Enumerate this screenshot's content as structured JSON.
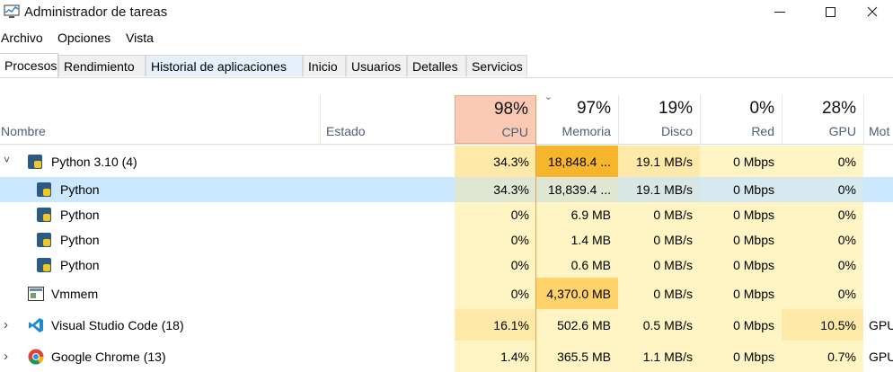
{
  "window": {
    "title": "Administrador de tareas",
    "controls": {
      "minimize": "—",
      "maximize": "☐",
      "close": "✕"
    }
  },
  "menu": [
    "Archivo",
    "Opciones",
    "Vista"
  ],
  "tabs": [
    {
      "label": "Procesos",
      "active": true
    },
    {
      "label": "Rendimiento"
    },
    {
      "label": "Historial de aplicaciones",
      "highlight": true
    },
    {
      "label": "Inicio"
    },
    {
      "label": "Usuarios"
    },
    {
      "label": "Detalles"
    },
    {
      "label": "Servicios"
    }
  ],
  "columns": {
    "name": "Nombre",
    "status": "Estado",
    "cpu": {
      "pct": "98%",
      "label": "CPU"
    },
    "memory": {
      "pct": "97%",
      "label": "Memoria",
      "sort_indicator": "ˇ"
    },
    "disk": {
      "pct": "19%",
      "label": "Disco"
    },
    "network": {
      "pct": "0%",
      "label": "Red"
    },
    "gpu": {
      "pct": "28%",
      "label": "GPU"
    },
    "gpu_engine": {
      "label": "Mot"
    }
  },
  "rows": [
    {
      "name": "Python 3.10 (4)",
      "expand": "˅",
      "cpu": "34.3%",
      "mem": "18,848.4 ...",
      "disk": "19.1 MB/s",
      "net": "0 Mbps",
      "gpu": "0%",
      "engine": ""
    },
    {
      "name": "Python",
      "cpu": "34.3%",
      "mem": "18,839.4 ...",
      "disk": "19.1 MB/s",
      "net": "0 Mbps",
      "gpu": "0%",
      "engine": ""
    },
    {
      "name": "Python",
      "cpu": "0%",
      "mem": "6.9 MB",
      "disk": "0 MB/s",
      "net": "0 Mbps",
      "gpu": "0%",
      "engine": ""
    },
    {
      "name": "Python",
      "cpu": "0%",
      "mem": "1.4 MB",
      "disk": "0 MB/s",
      "net": "0 Mbps",
      "gpu": "0%",
      "engine": ""
    },
    {
      "name": "Python",
      "cpu": "0%",
      "mem": "0.6 MB",
      "disk": "0 MB/s",
      "net": "0 Mbps",
      "gpu": "0%",
      "engine": ""
    },
    {
      "name": "Vmmem",
      "cpu": "0%",
      "mem": "4,370.0 MB",
      "disk": "0 MB/s",
      "net": "0 Mbps",
      "gpu": "0%",
      "engine": ""
    },
    {
      "name": "Visual Studio Code (18)",
      "expand": "›",
      "cpu": "16.1%",
      "mem": "502.6 MB",
      "disk": "0.5 MB/s",
      "net": "0 Mbps",
      "gpu": "10.5%",
      "engine": "GPU"
    },
    {
      "name": "Google Chrome (13)",
      "expand": "›",
      "cpu": "1.4%",
      "mem": "365.5 MB",
      "disk": "1.1 MB/s",
      "net": "0 Mbps",
      "gpu": "0.7%",
      "engine": "GPU"
    }
  ],
  "colors": {
    "heat_light": "#fff4c4",
    "heat_mid": "#ffe9a8",
    "heat_strong": "#ffd26a",
    "heat_max": "#f7b52c",
    "cpu_header": "#f9c9b3",
    "selection": "#cce8ff"
  }
}
